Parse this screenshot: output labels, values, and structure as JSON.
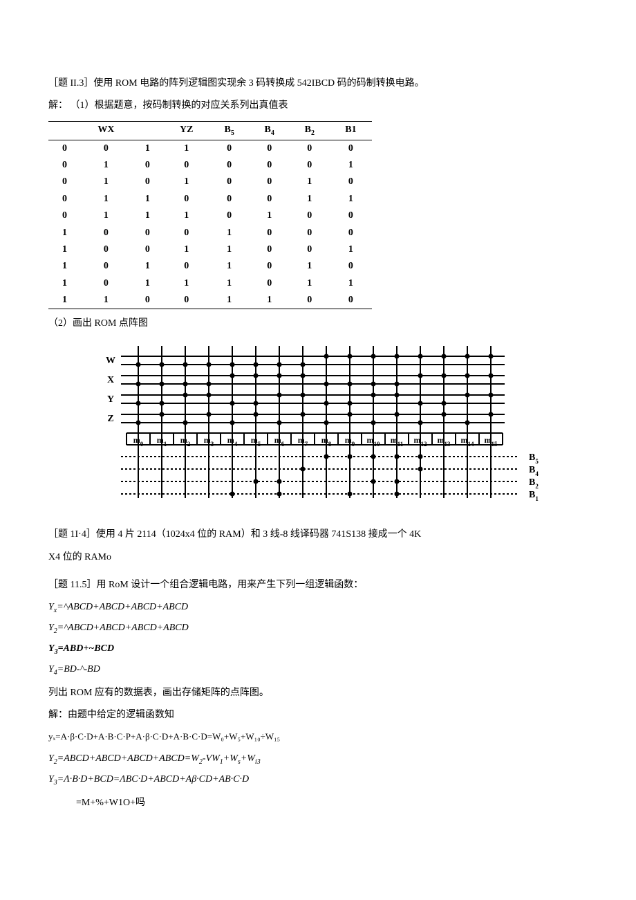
{
  "problem113": {
    "title": "［题 II.3］使用 ROM 电路的阵列逻辑图实现余 3 码转换成 542IBCD 码的码制转换电路。",
    "step1_label": "解： （1）根据题意，按码制转换的对应关系列出真值表",
    "table": {
      "header": [
        "",
        "WX",
        "",
        "YZ",
        "B5",
        "B4",
        "B2",
        "B1"
      ],
      "rows": [
        [
          "0",
          "0",
          "1",
          "1",
          "0",
          "0",
          "0",
          "0"
        ],
        [
          "0",
          "1",
          "0",
          "0",
          "0",
          "0",
          "0",
          "1"
        ],
        [
          "0",
          "1",
          "0",
          "1",
          "0",
          "0",
          "1",
          "0"
        ],
        [
          "0",
          "1",
          "1",
          "0",
          "0",
          "0",
          "1",
          "1"
        ],
        [
          "0",
          "1",
          "1",
          "1",
          "0",
          "1",
          "0",
          "0"
        ],
        [
          "1",
          "0",
          "0",
          "0",
          "1",
          "0",
          "0",
          "0"
        ],
        [
          "1",
          "0",
          "0",
          "1",
          "1",
          "0",
          "0",
          "1"
        ],
        [
          "1",
          "0",
          "1",
          "0",
          "1",
          "0",
          "1",
          "0"
        ],
        [
          "1",
          "0",
          "1",
          "1",
          "1",
          "0",
          "1",
          "1"
        ],
        [
          "1",
          "1",
          "0",
          "0",
          "1",
          "1",
          "0",
          "0"
        ]
      ]
    },
    "step2_label": "（2）画出 ROM 点阵图",
    "rom": {
      "row_labels": [
        "W",
        "X",
        "Y",
        "Z"
      ],
      "m_labels": [
        "m0",
        "m1",
        "m2",
        "m3",
        "m4",
        "m5",
        "m6",
        "m7",
        "m8",
        "m9",
        "m10",
        "m11",
        "m12",
        "m13",
        "m14",
        "m15"
      ],
      "out_labels": [
        "B5",
        "B4",
        "B2",
        "B1"
      ]
    }
  },
  "problem114": {
    "title": "［题 1I·4］使用 4 片 2114（1024x4 位的 RAM）和 3 线-8 线译码器 741S138 接成一个 4K",
    "line2": "X4 位的 RAMo"
  },
  "problem115": {
    "title": "［题 11.5］用 RoM 设计一个组合逻辑电路，用来产生下列一组逻辑函数：",
    "eq1": {
      "lhs": "Yx",
      "rhs": "=^ABCD+ABCD+ABCD+ABCD"
    },
    "eq2": {
      "lhs": "Y2",
      "rhs": "=^ABCD+ABCD+ABCD+ABCD"
    },
    "eq3": {
      "lhs": "Y3",
      "rhs": "=ABD+~BCD"
    },
    "eq4": {
      "lhs": "Y4",
      "rhs": "=BD-^-BD"
    },
    "note": "列出 ROM 应有的数据表，画出存储矩阵的点阵图。",
    "sol_intro": "解：由题中给定的逻辑函数知",
    "sol_eq1": "yₓ=A·β·C·D+A·B·C·P+A·β·C·D+A·B·C·D=W₀+W₅+W₁₀÷W₁₅",
    "sol_eq2": {
      "lhs": "Y2",
      "rhs": "=ABCD+ABCD+ABCD+ABCD=W2-VW1+Ws+Wi3"
    },
    "sol_eq3": {
      "lhs": "Y3",
      "rhs": "=Λ·B·D+BCD=ΛBC·D+ABCD+Aβ·CD+AB·C·D"
    },
    "sol_eq4": "=M+%+W1O+吗"
  }
}
